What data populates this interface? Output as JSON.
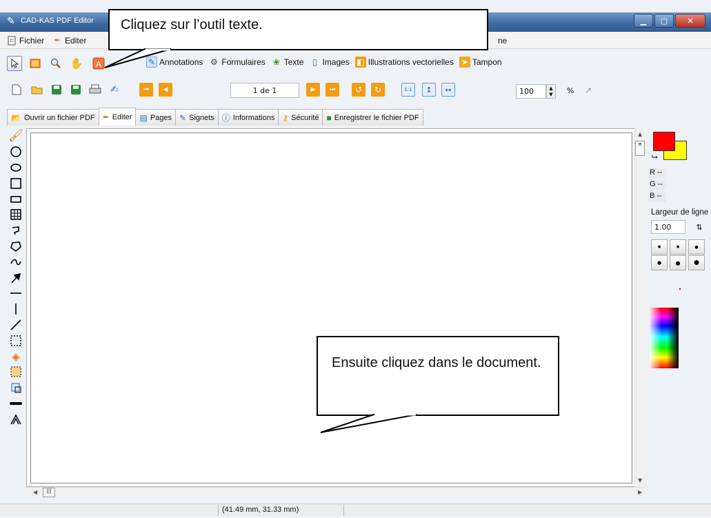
{
  "window": {
    "title": "CAD-KAS PDF Editor",
    "minimize": "▁",
    "maximize": "▢",
    "close": "✕"
  },
  "menu": {
    "items": [
      {
        "label": "Fichier",
        "icon": "document-icon"
      },
      {
        "label": "Editer",
        "icon": "quill-icon"
      }
    ],
    "partial_suffix": "ne"
  },
  "categories": [
    {
      "label": "Annotations",
      "icon": "annotation-icon",
      "color": "#6aa84f"
    },
    {
      "label": "Formulaires",
      "icon": "gear-icon",
      "color": "#555555"
    },
    {
      "label": "Texte",
      "icon": "text-tool-icon",
      "color": "#3f8f2f"
    },
    {
      "label": "Images",
      "icon": "image-icon",
      "color": "#3b6db2"
    },
    {
      "label": "Illustrations vectorielles",
      "icon": "vector-icon",
      "color": "#e69138"
    },
    {
      "label": "Tampon",
      "icon": "stamp-icon",
      "color": "#f1a91c"
    }
  ],
  "navigation": {
    "page_indicator": "1 de 1",
    "zoom_value": "100",
    "zoom_unit": "%"
  },
  "tabs": [
    {
      "label": "Ouvrir un fichier PDF",
      "icon": "folder-open-icon",
      "active": false
    },
    {
      "label": "Editer",
      "icon": "quill-icon",
      "active": true
    },
    {
      "label": "Pages",
      "icon": "pages-icon",
      "active": false
    },
    {
      "label": "Signets",
      "icon": "bookmark-icon",
      "active": false
    },
    {
      "label": "Informations",
      "icon": "info-icon",
      "active": false
    },
    {
      "label": "Sécurité",
      "icon": "key-icon",
      "active": false
    },
    {
      "label": "Enregistrer le fichier PDF",
      "icon": "save-icon",
      "active": false
    }
  ],
  "right_panel": {
    "primary_color": "#ff0000",
    "secondary_color": "#ffff00",
    "r": "R --",
    "g": "G --",
    "b": "B --",
    "line_width_label": "Largeur de ligne",
    "line_width_value": "1.00"
  },
  "status": {
    "coordinates": "(41.49 mm, 31.33 mm)"
  },
  "callouts": {
    "top": "Cliquez sur l’outil texte.",
    "bottom": "Ensuite cliquez dans le document."
  }
}
